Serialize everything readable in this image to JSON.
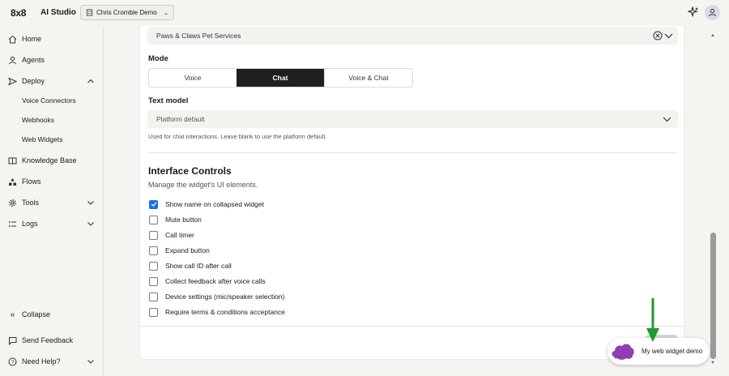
{
  "header": {
    "logo": "8x8",
    "app_title": "AI Studio",
    "workspace": "Chris Crombie Demo"
  },
  "sidebar": {
    "items": [
      {
        "label": "Home",
        "icon": "home-icon"
      },
      {
        "label": "Agents",
        "icon": "user-icon"
      },
      {
        "label": "Deploy",
        "icon": "deploy-icon",
        "expanded": true
      },
      {
        "label": "Knowledge Base",
        "icon": "book-icon"
      },
      {
        "label": "Flows",
        "icon": "flows-icon"
      },
      {
        "label": "Tools",
        "icon": "gear-icon"
      },
      {
        "label": "Logs",
        "icon": "list-icon"
      }
    ],
    "deploy_sub": [
      "Voice Connectors",
      "Webhooks",
      "Web Widgets"
    ],
    "collapse": "Collapse",
    "send_feedback": "Send Feedback",
    "need_help": "Need Help?"
  },
  "form": {
    "agent_value": "Paws & Claws Pet Services",
    "mode_label": "Mode",
    "mode_options": [
      "Voice",
      "Chat",
      "Voice & Chat"
    ],
    "mode_selected": "Chat",
    "text_model_label": "Text model",
    "text_model_value": "Platform default",
    "text_model_helper": "Used for chat interactions. Leave blank to use the platform default.",
    "interface_title": "Interface Controls",
    "interface_sub": "Manage the widget's UI elements.",
    "controls": [
      {
        "label": "Show name on collapsed widget",
        "checked": true
      },
      {
        "label": "Mute button",
        "checked": false
      },
      {
        "label": "Call timer",
        "checked": false
      },
      {
        "label": "Expand button",
        "checked": false
      },
      {
        "label": "Show call ID after call",
        "checked": false
      },
      {
        "label": "Collect feedback after voice calls",
        "checked": false
      },
      {
        "label": "Device settings (mic/speaker selection)",
        "checked": false
      },
      {
        "label": "Require terms & conditions acceptance",
        "checked": false
      }
    ]
  },
  "widget": {
    "name": "My web widget demo"
  },
  "colors": {
    "accent": "#1d6ee8",
    "mode_active_bg": "#1f1f1f",
    "blob": "#8e3fb3",
    "arrow": "#1e9a2e"
  }
}
